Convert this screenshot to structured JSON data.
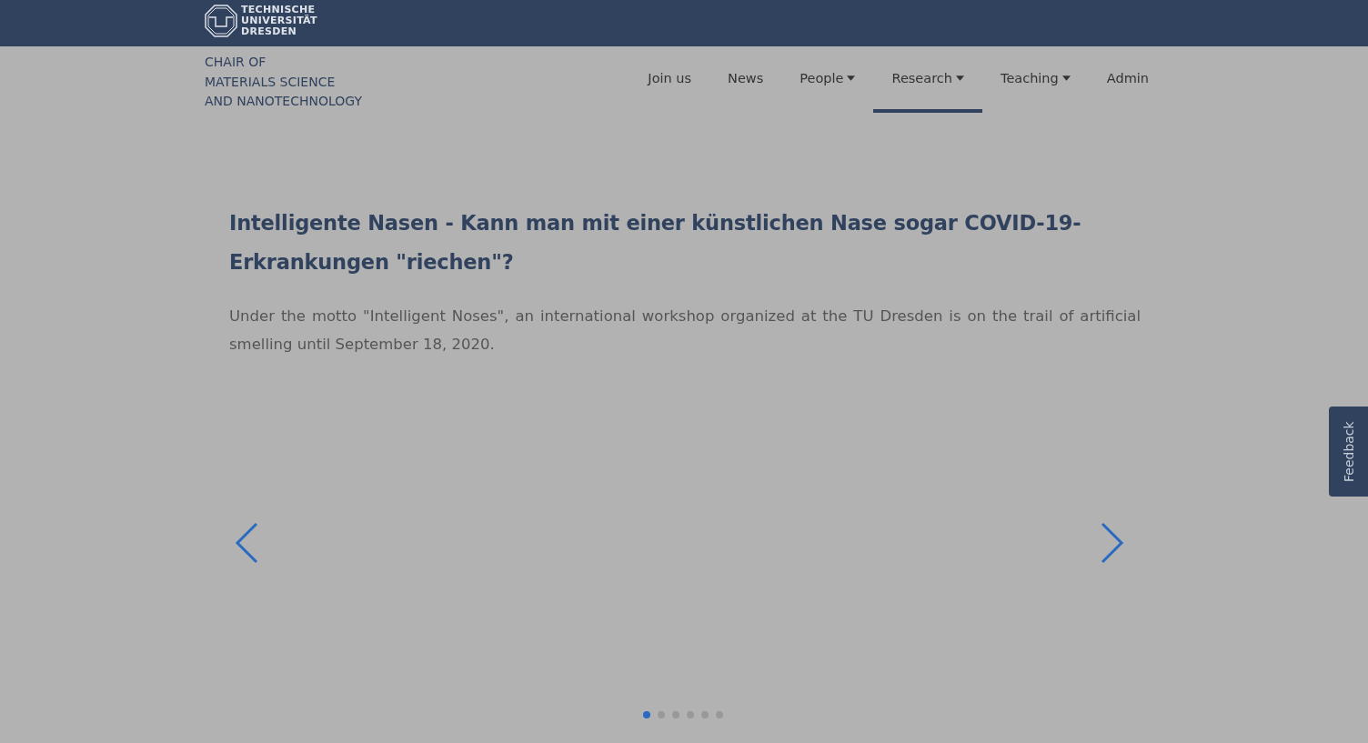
{
  "brand": {
    "logo_lines": [
      "TECHNISCHE",
      "UNIVERSITÄT",
      "DRESDEN"
    ]
  },
  "site_title_lines": [
    "CHAIR OF",
    "MATERIALS SCIENCE",
    "AND NANOTECHNOLOGY"
  ],
  "nav": [
    {
      "label": "Join us",
      "dropdown": false,
      "selected": false
    },
    {
      "label": "News",
      "dropdown": false,
      "selected": false
    },
    {
      "label": "People",
      "dropdown": true,
      "selected": false
    },
    {
      "label": "Research",
      "dropdown": true,
      "selected": true
    },
    {
      "label": "Teaching",
      "dropdown": true,
      "selected": false
    },
    {
      "label": "Admin",
      "dropdown": false,
      "selected": false
    }
  ],
  "slide": {
    "title": "Intelligente Nasen - Kann man mit einer künstlichen Nase sogar COVID-19-Erkrankungen \"riechen\"?",
    "text": "Under the motto \"Intelligent Noses\", an international workshop organized at the TU Dresden is on the trail of artificial smelling until September 18, 2020."
  },
  "indicators": [
    {
      "selected": true
    },
    {
      "selected": false
    },
    {
      "selected": false
    },
    {
      "selected": false
    },
    {
      "selected": false
    },
    {
      "selected": false
    }
  ],
  "feedback_tab": {
    "label": "Feedback"
  }
}
